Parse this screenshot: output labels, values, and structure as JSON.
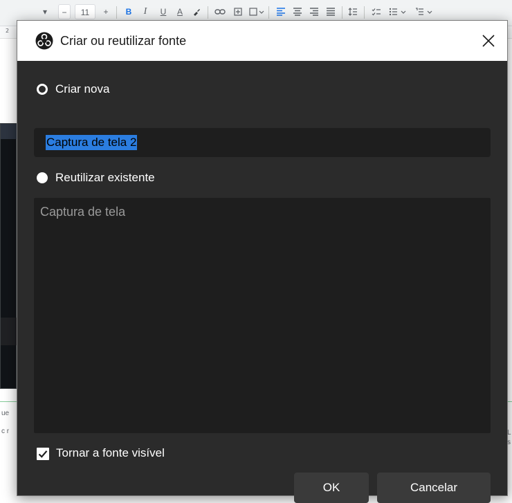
{
  "background": {
    "toolbar": {
      "font_size": "11",
      "bold": "B",
      "italic": "I",
      "underline": "U",
      "text_color": "A",
      "minus": "−",
      "plus": "+"
    },
    "ruler_number": "2",
    "side_text_left_1": "ue",
    "side_text_left_2": "c r",
    "side_text_right_1": "L",
    "side_text_right_2": "s"
  },
  "dialog": {
    "title": "Criar ou reutilizar fonte",
    "app_icon": "obs-studio-logo",
    "close_icon": "close-x-icon",
    "create_new": {
      "label": "Criar nova",
      "selected": true
    },
    "name_input": {
      "value": "Captura de tela 2",
      "selected_text": true
    },
    "reuse_existing": {
      "label": "Reutilizar existente",
      "selected": false
    },
    "existing_sources": [
      "Captura de tela"
    ],
    "make_visible": {
      "label": "Tornar a fonte visível",
      "checked": true
    },
    "buttons": {
      "ok": "OK",
      "cancel": "Cancelar"
    }
  },
  "colors": {
    "dialog_bg": "#2b2b2b",
    "input_bg": "#1e1e1e",
    "selection": "#2b7de0",
    "button_bg": "#3a3a3a",
    "titlebar_bg": "#ffffff"
  }
}
